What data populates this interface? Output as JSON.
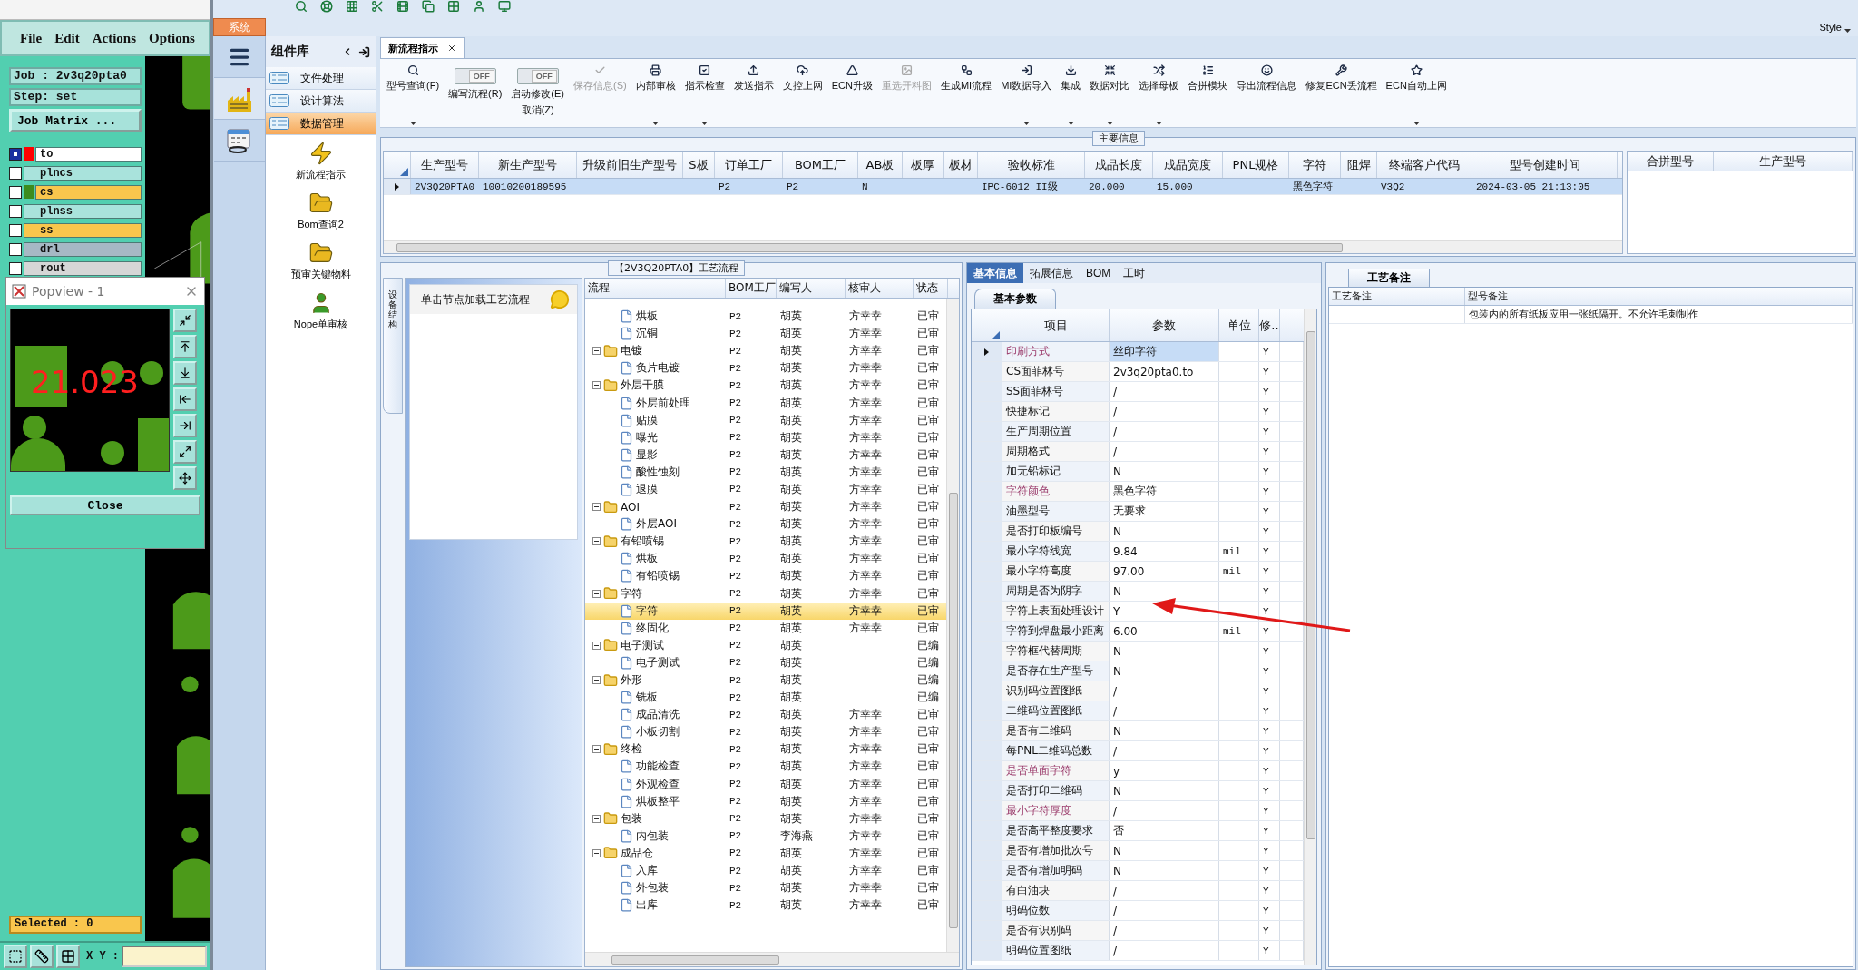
{
  "editor": {
    "menu": [
      "File",
      "Edit",
      "Actions",
      "Options"
    ],
    "job": "Job : 2v3q20pta0",
    "step": "Step: set",
    "job_matrix": "Job Matrix ...",
    "layers": [
      {
        "name": "to",
        "color": "#ffffff",
        "swatch": {
          "color": "#ff0000"
        },
        "active": true
      },
      {
        "name": "plncs",
        "color": "#a9e3dc",
        "active": false
      },
      {
        "name": "cs",
        "color": "#f9c64d",
        "swatch": {
          "color": "#3c8c1e"
        },
        "active": false
      },
      {
        "name": "plnss",
        "color": "#a9e3dc",
        "active": false
      },
      {
        "name": "ss",
        "color": "#f9c64d",
        "active": false
      },
      {
        "name": "drl",
        "color": "#a6b8c4",
        "active": false
      },
      {
        "name": "rout",
        "color": "#d6d6d6",
        "active": false
      }
    ],
    "popview": {
      "title": "Popview - 1",
      "measure": "21.023",
      "close": "Close"
    },
    "selected": "Selected : 0",
    "xy_label": "X Y :"
  },
  "app": {
    "system_tab": "系统",
    "style": "Style"
  },
  "library": {
    "title": "组件库",
    "categories": [
      {
        "label": "文件处理",
        "selected": false
      },
      {
        "label": "设计算法",
        "selected": false
      },
      {
        "label": "数据管理",
        "selected": true
      }
    ],
    "tools": [
      "新流程指示",
      "Bom查询2",
      "预审关键物料",
      "Nope单审核"
    ]
  },
  "doc_tab": {
    "label": "新流程指示",
    "selected": true
  },
  "ribbon": [
    {
      "kind": "button",
      "label": "型号查询(F)",
      "disabled": false,
      "dropdown": true
    },
    {
      "kind": "toggle",
      "state": "OFF",
      "on": false,
      "label": "编写流程(R)"
    },
    {
      "kind": "toggle",
      "state": "OFF",
      "on": false,
      "label": "启动修改(E)",
      "sublabel": "取消(Z)"
    },
    {
      "kind": "button",
      "label": "保存信息(S)",
      "disabled": true,
      "dropdown": false
    },
    {
      "kind": "button",
      "label": "内部审核",
      "disabled": false,
      "dropdown": true
    },
    {
      "kind": "button",
      "label": "指示检查",
      "disabled": false,
      "dropdown": true
    },
    {
      "kind": "button",
      "label": "发送指示",
      "disabled": false,
      "dropdown": false
    },
    {
      "kind": "button",
      "label": "文控上网",
      "disabled": false,
      "dropdown": false
    },
    {
      "kind": "button",
      "label": "ECN升级",
      "disabled": false,
      "dropdown": false
    },
    {
      "kind": "button",
      "label": "重选开料图",
      "disabled": true,
      "dropdown": false
    },
    {
      "kind": "button",
      "label": "生成MI流程",
      "disabled": false,
      "dropdown": false
    },
    {
      "kind": "button",
      "label": "MI数据导入",
      "disabled": false,
      "dropdown": true
    },
    {
      "kind": "button",
      "label": "集成",
      "disabled": false,
      "dropdown": true
    },
    {
      "kind": "button",
      "label": "数据对比",
      "disabled": false,
      "dropdown": true
    },
    {
      "kind": "button",
      "label": "选择母板",
      "disabled": false,
      "dropdown": true
    },
    {
      "kind": "button",
      "label": "合拼模块",
      "disabled": false,
      "dropdown": false
    },
    {
      "kind": "button",
      "label": "导出流程信息",
      "disabled": false,
      "dropdown": false
    },
    {
      "kind": "button",
      "label": "修复ECN丢流程",
      "disabled": false,
      "dropdown": false
    },
    {
      "kind": "button",
      "label": "ECN自动上网",
      "disabled": false,
      "dropdown": true
    }
  ],
  "main_info": {
    "title": "主要信息",
    "columns": [
      "生产型号",
      "新生产型号",
      "升级前旧生产型号",
      "S板",
      "订单工厂",
      "BOM工厂",
      "AB板",
      "板厚",
      "板材",
      "验收标准",
      "成品长度",
      "成品宽度",
      "PNL规格",
      "字符",
      "阻焊",
      "终端客户代码",
      "型号创建时间"
    ],
    "rows": [
      {
        "selected": true,
        "cells": [
          "2V3Q20PTA0",
          "10010200189595",
          null,
          null,
          "P2",
          "P2",
          "N",
          null,
          null,
          "IPC-6012 II级",
          "20.000",
          "15.000",
          null,
          "黑色字符",
          null,
          "V3Q2",
          "2024-03-05 21:13:05"
        ]
      }
    ],
    "side_columns": [
      "合拼型号",
      "生产型号"
    ]
  },
  "process": {
    "title": "【2V3Q20PTA0】工艺流程",
    "side_tab": "设备结构",
    "hint": "单击节点加载工艺流程",
    "columns": [
      "流程",
      "BOM工厂",
      "编写人",
      "核审人",
      "状态"
    ],
    "nodes": [
      {
        "children": [
          {
            "label": "烘板",
            "bom": "P2",
            "writer": "胡英",
            "reviewer": "方幸幸",
            "status": "已审",
            "selected": false
          },
          {
            "label": "沉铜",
            "bom": "P2",
            "writer": "胡英",
            "reviewer": "方幸幸",
            "status": "已审",
            "selected": false
          }
        ]
      },
      {
        "label": "电镀",
        "bom": "P2",
        "writer": "胡英",
        "reviewer": "方幸幸",
        "status": "已审",
        "selected": false,
        "expanded": true,
        "children": [
          {
            "label": "负片电镀",
            "bom": "P2",
            "writer": "胡英",
            "reviewer": "方幸幸",
            "status": "已审",
            "selected": false
          }
        ]
      },
      {
        "label": "外层干膜",
        "bom": "P2",
        "writer": "胡英",
        "reviewer": "方幸幸",
        "status": "已审",
        "selected": false,
        "expanded": true,
        "children": [
          {
            "label": "外层前处理",
            "bom": "P2",
            "writer": "胡英",
            "reviewer": "方幸幸",
            "status": "已审",
            "selected": false
          },
          {
            "label": "贴膜",
            "bom": "P2",
            "writer": "胡英",
            "reviewer": "方幸幸",
            "status": "已审",
            "selected": false
          },
          {
            "label": "曝光",
            "bom": "P2",
            "writer": "胡英",
            "reviewer": "方幸幸",
            "status": "已审",
            "selected": false
          },
          {
            "label": "显影",
            "bom": "P2",
            "writer": "胡英",
            "reviewer": "方幸幸",
            "status": "已审",
            "selected": false
          },
          {
            "label": "酸性蚀刻",
            "bom": "P2",
            "writer": "胡英",
            "reviewer": "方幸幸",
            "status": "已审",
            "selected": false
          },
          {
            "label": "退膜",
            "bom": "P2",
            "writer": "胡英",
            "reviewer": "方幸幸",
            "status": "已审",
            "selected": false
          }
        ]
      },
      {
        "label": "AOI",
        "bom": "P2",
        "writer": "胡英",
        "reviewer": "方幸幸",
        "status": "已审",
        "selected": false,
        "expanded": true,
        "children": [
          {
            "label": "外层AOI",
            "bom": "P2",
            "writer": "胡英",
            "reviewer": "方幸幸",
            "status": "已审",
            "selected": false
          }
        ]
      },
      {
        "label": "有铅喷锡",
        "bom": "P2",
        "writer": "胡英",
        "reviewer": "方幸幸",
        "status": "已审",
        "selected": false,
        "expanded": true,
        "children": [
          {
            "label": "烘板",
            "bom": "P2",
            "writer": "胡英",
            "reviewer": "方幸幸",
            "status": "已审",
            "selected": false
          },
          {
            "label": "有铅喷锡",
            "bom": "P2",
            "writer": "胡英",
            "reviewer": "方幸幸",
            "status": "已审",
            "selected": false
          }
        ]
      },
      {
        "label": "字符",
        "bom": "P2",
        "writer": "胡英",
        "reviewer": "方幸幸",
        "status": "已审",
        "selected": false,
        "expanded": true,
        "children": [
          {
            "label": "字符",
            "bom": "P2",
            "writer": "胡英",
            "reviewer": "方幸幸",
            "status": "已审",
            "selected": true
          },
          {
            "label": "终固化",
            "bom": "P2",
            "writer": "胡英",
            "reviewer": "方幸幸",
            "status": "已审",
            "selected": false
          }
        ]
      },
      {
        "label": "电子测试",
        "bom": "P2",
        "writer": "胡英",
        "status": "已编",
        "selected": false,
        "expanded": true,
        "children": [
          {
            "label": "电子测试",
            "bom": "P2",
            "writer": "胡英",
            "status": "已编",
            "selected": false
          }
        ]
      },
      {
        "label": "外形",
        "bom": "P2",
        "writer": "胡英",
        "status": "已编",
        "selected": false,
        "expanded": true,
        "children": [
          {
            "label": "铣板",
            "bom": "P2",
            "writer": "胡英",
            "status": "已编",
            "selected": false
          },
          {
            "label": "成品清洗",
            "bom": "P2",
            "writer": "胡英",
            "reviewer": "方幸幸",
            "status": "已审",
            "selected": false
          },
          {
            "label": "小板切割",
            "bom": "P2",
            "writer": "胡英",
            "reviewer": "方幸幸",
            "status": "已审",
            "selected": false
          }
        ]
      },
      {
        "label": "终检",
        "bom": "P2",
        "writer": "胡英",
        "reviewer": "方幸幸",
        "status": "已审",
        "selected": false,
        "expanded": true,
        "children": [
          {
            "label": "功能检查",
            "bom": "P2",
            "writer": "胡英",
            "reviewer": "方幸幸",
            "status": "已审",
            "selected": false
          },
          {
            "label": "外观检查",
            "bom": "P2",
            "writer": "胡英",
            "reviewer": "方幸幸",
            "status": "已审",
            "selected": false
          },
          {
            "label": "烘板整平",
            "bom": "P2",
            "writer": "胡英",
            "reviewer": "方幸幸",
            "status": "已审",
            "selected": false
          }
        ]
      },
      {
        "label": "包装",
        "bom": "P2",
        "writer": "胡英",
        "reviewer": "方幸幸",
        "status": "已审",
        "selected": false,
        "expanded": true,
        "children": [
          {
            "label": "内包装",
            "bom": "P2",
            "writer": "李海燕",
            "reviewer": "方幸幸",
            "status": "已审",
            "selected": false
          }
        ]
      },
      {
        "label": "成品仓",
        "bom": "P2",
        "writer": "胡英",
        "reviewer": "方幸幸",
        "status": "已审",
        "selected": false,
        "expanded": true,
        "children": [
          {
            "label": "入库",
            "bom": "P2",
            "writer": "胡英",
            "reviewer": "方幸幸",
            "status": "已审",
            "selected": false
          },
          {
            "label": "外包装",
            "bom": "P2",
            "writer": "胡英",
            "reviewer": "方幸幸",
            "status": "已审",
            "selected": false
          },
          {
            "label": "出库",
            "bom": "P2",
            "writer": "胡英",
            "reviewer": "方幸幸",
            "status": "已审",
            "selected": false
          }
        ]
      }
    ]
  },
  "info": {
    "tabs": [
      {
        "label": "基本信息",
        "selected": true
      },
      {
        "label": "拓展信息",
        "selected": false
      },
      {
        "label": "BOM",
        "selected": false
      },
      {
        "label": "工时",
        "selected": false
      }
    ],
    "subtab": "基本参数",
    "columns": [
      "项目",
      "参数",
      "单位",
      "修.."
    ],
    "rows": [
      {
        "item": "印刷方式",
        "value": "丝印字符",
        "flag": "Y",
        "highlight": true,
        "selected": true
      },
      {
        "item": "CS面菲林号",
        "value": "2v3q20pta0.to",
        "flag": "Y",
        "highlight": false,
        "selected": false
      },
      {
        "item": "SS面菲林号",
        "value": "/",
        "flag": "Y",
        "highlight": false,
        "selected": false
      },
      {
        "item": "快捷标记",
        "value": "/",
        "flag": "Y",
        "highlight": false,
        "selected": false
      },
      {
        "item": "生产周期位置",
        "value": "/",
        "flag": "Y",
        "highlight": false,
        "selected": false
      },
      {
        "item": "周期格式",
        "value": "/",
        "flag": "Y",
        "highlight": false,
        "selected": false
      },
      {
        "item": "加无铅标记",
        "value": "N",
        "flag": "Y",
        "highlight": false,
        "selected": false
      },
      {
        "item": "字符颜色",
        "value": "黑色字符",
        "flag": "Y",
        "highlight": true,
        "selected": false
      },
      {
        "item": "油墨型号",
        "value": "无要求",
        "flag": "Y",
        "highlight": false,
        "selected": false
      },
      {
        "item": "是否打印板编号",
        "value": "N",
        "flag": "Y",
        "highlight": false,
        "selected": false
      },
      {
        "item": "最小字符线宽",
        "value": "9.84",
        "unit": "mil",
        "flag": "Y",
        "highlight": false,
        "selected": false
      },
      {
        "item": "最小字符高度",
        "value": "97.00",
        "unit": "mil",
        "flag": "Y",
        "highlight": false,
        "selected": false
      },
      {
        "item": "周期是否为阴字",
        "value": "N",
        "flag": "Y",
        "highlight": false,
        "selected": false
      },
      {
        "item": "字符上表面处理设计",
        "value": "Y",
        "flag": "Y",
        "highlight": false,
        "selected": false
      },
      {
        "item": "字符到焊盘最小距离",
        "value": "6.00",
        "unit": "mil",
        "flag": "Y",
        "highlight": false,
        "selected": false
      },
      {
        "item": "字符框代替周期",
        "value": "N",
        "flag": "Y",
        "highlight": false,
        "selected": false
      },
      {
        "item": "是否存在生产型号",
        "value": "N",
        "flag": "Y",
        "highlight": false,
        "selected": false
      },
      {
        "item": "识别码位置图纸",
        "value": "/",
        "flag": "Y",
        "highlight": false,
        "selected": false
      },
      {
        "item": "二维码位置图纸",
        "value": "/",
        "flag": "Y",
        "highlight": false,
        "selected": false
      },
      {
        "item": "是否有二维码",
        "value": "N",
        "flag": "Y",
        "highlight": false,
        "selected": false
      },
      {
        "item": "每PNL二维码总数",
        "value": "/",
        "flag": "Y",
        "highlight": false,
        "selected": false
      },
      {
        "item": "是否单面字符",
        "value": "y",
        "flag": "Y",
        "highlight": true,
        "selected": false
      },
      {
        "item": "是否打印二维码",
        "value": "N",
        "flag": "Y",
        "highlight": false,
        "selected": false
      },
      {
        "item": "最小字符厚度",
        "value": "/",
        "flag": "Y",
        "highlight": true,
        "selected": false
      },
      {
        "item": "是否高平整度要求",
        "value": "否",
        "flag": "Y",
        "highlight": false,
        "selected": false
      },
      {
        "item": "是否有增加批次号",
        "value": "N",
        "flag": "Y",
        "highlight": false,
        "selected": false
      },
      {
        "item": "是否有增加明码",
        "value": "N",
        "flag": "Y",
        "highlight": false,
        "selected": false
      },
      {
        "item": "有白油块",
        "value": "/",
        "flag": "Y",
        "highlight": false,
        "selected": false
      },
      {
        "item": "明码位数",
        "value": "/",
        "flag": "Y",
        "highlight": false,
        "selected": false
      },
      {
        "item": "是否有识别码",
        "value": "/",
        "flag": "Y",
        "highlight": false,
        "selected": false
      },
      {
        "item": "明码位置图纸",
        "value": "/",
        "flag": "Y",
        "highlight": false,
        "selected": false
      }
    ]
  },
  "notes": {
    "tab": "工艺备注",
    "columns": [
      "工艺备注",
      "型号备注"
    ],
    "rows": [
      {
        "process_note": null,
        "model_note": "包装内的所有纸板应用一张纸隔开。不允许毛刺制作"
      }
    ]
  }
}
